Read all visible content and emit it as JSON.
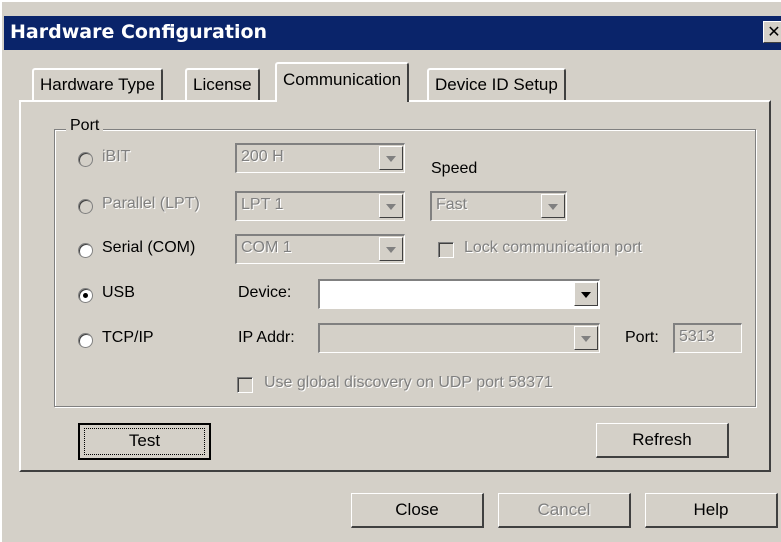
{
  "window": {
    "title": "Hardware Configuration",
    "close_glyph": "✕"
  },
  "tabs": [
    {
      "label": "Hardware Type"
    },
    {
      "label": "License"
    },
    {
      "label": "Communication"
    },
    {
      "label": "Device ID Setup"
    }
  ],
  "port_group": {
    "label": "Port",
    "ibit": {
      "label": "iBIT",
      "value": "200 H"
    },
    "parallel": {
      "label": "Parallel (LPT)",
      "value": "LPT 1"
    },
    "serial": {
      "label": "Serial (COM)",
      "value": "COM 1"
    },
    "usb": {
      "label": "USB",
      "device_label": "Device:",
      "device_value": ""
    },
    "tcpip": {
      "label": "TCP/IP",
      "ip_label": "IP Addr:",
      "ip_value": "",
      "port_label": "Port:",
      "port_value": "5313"
    },
    "speed": {
      "label": "Speed",
      "value": "Fast"
    },
    "lock_port": {
      "label": "Lock communication port",
      "checked": false
    },
    "global_discovery": {
      "label": "Use global discovery on UDP port 58371",
      "checked": false
    },
    "selected": "USB"
  },
  "buttons": {
    "test": "Test",
    "refresh": "Refresh",
    "close": "Close",
    "cancel": "Cancel",
    "help": "Help"
  }
}
